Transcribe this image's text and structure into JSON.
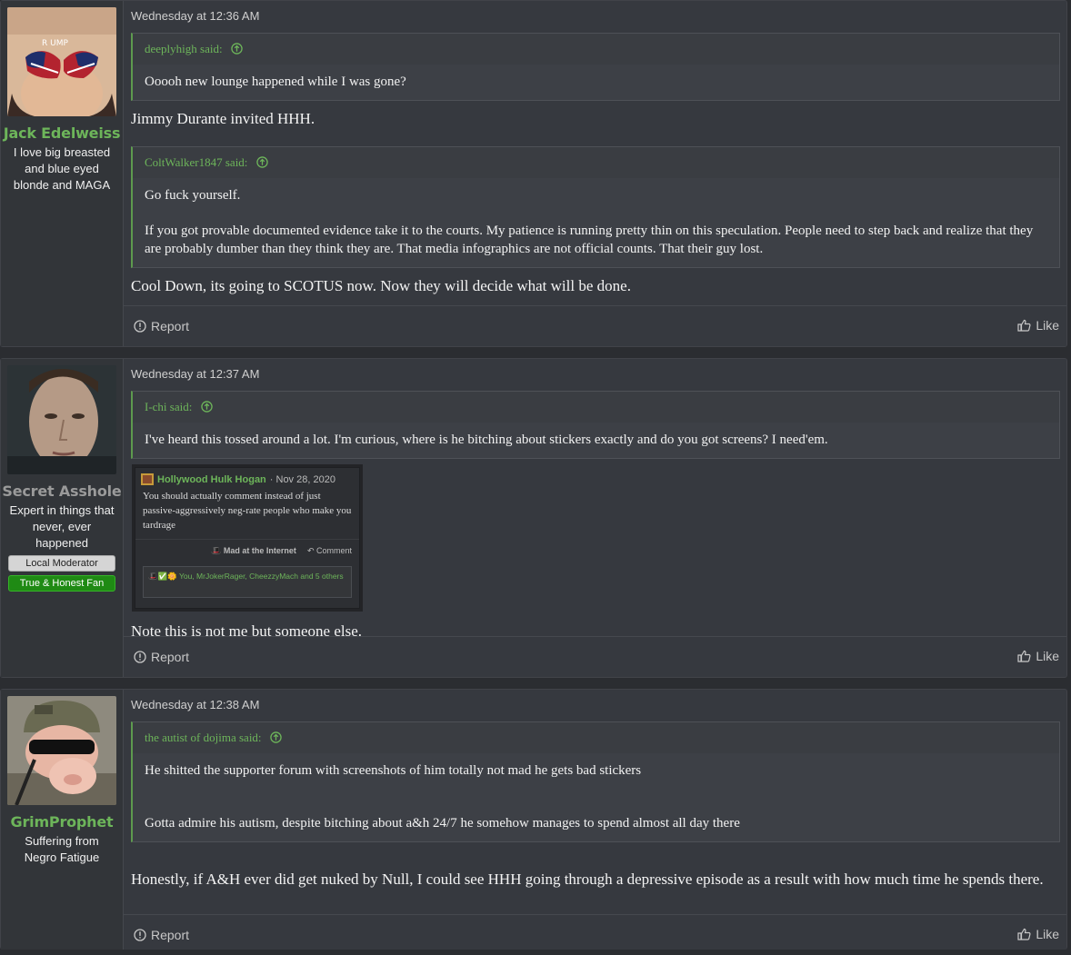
{
  "posts": [
    {
      "username": "Jack Edelweiss",
      "user_title": "I love big breasted and blue eyed blonde and MAGA",
      "user_color": "#6db55a",
      "date": "Wednesday at 12:36 AM",
      "quotes": [
        {
          "author": "deeplyhigh",
          "said": "said:",
          "text": [
            "Ooooh new lounge happened while I was gone?"
          ]
        },
        {
          "author": "ColtWalker1847",
          "said": "said:",
          "text": [
            "Go fuck yourself.",
            "If you got provable documented evidence take it to the courts. My patience is running pretty thin on this speculation. People need to step back and realize that they are probably dumber than they think they are. That media infographics are not official counts. That their guy lost."
          ]
        }
      ],
      "replies": [
        "Jimmy Durante invited HHH.",
        "Cool Down, its going to SCOTUS now. Now they will decide what will be done."
      ],
      "report_label": "Report",
      "like_label": "Like"
    },
    {
      "username": "Secret Asshole",
      "user_title": "Expert in things that never, ever happened",
      "user_color": "#9a9a9a",
      "banners": [
        "Local Moderator",
        "True & Honest Fan"
      ],
      "date": "Wednesday at 12:37 AM",
      "quotes": [
        {
          "author": "I-chi",
          "said": "said:",
          "text": [
            "I've heard this tossed around a lot. I'm curious, where is he bitching about stickers exactly and do you got screens? I need'em."
          ]
        }
      ],
      "embed": {
        "author": "Hollywood Hulk Hogan",
        "date": "· Nov 28, 2020",
        "text": "You should actually comment instead of just passive-aggressively neg-rate people who make you tardrage",
        "rating": "Mad at the Internet",
        "comment": "Comment",
        "reactions": "You, MrJokerRager, CheezzyMach and 5 others"
      },
      "replies": [
        "Note this is not me but someone else."
      ],
      "report_label": "Report",
      "like_label": "Like"
    },
    {
      "username": "GrimProphet",
      "user_title": "Suffering from Negro Fatigue",
      "user_color": "#6db55a",
      "date": "Wednesday at 12:38 AM",
      "quotes": [
        {
          "author": "the autist of dojima",
          "said": "said:",
          "text": [
            "He shitted the supporter forum with screenshots of him totally not mad he gets bad stickers",
            "Gotta admire his autism, despite bitching about a&h 24/7 he somehow manages to spend almost all day there"
          ]
        }
      ],
      "replies": [
        "Honestly, if A&H ever did get nuked by Null, I could see HHH going through a depressive episode as a result with how much time he spends there."
      ],
      "report_label": "Report",
      "like_label": "Like"
    }
  ]
}
